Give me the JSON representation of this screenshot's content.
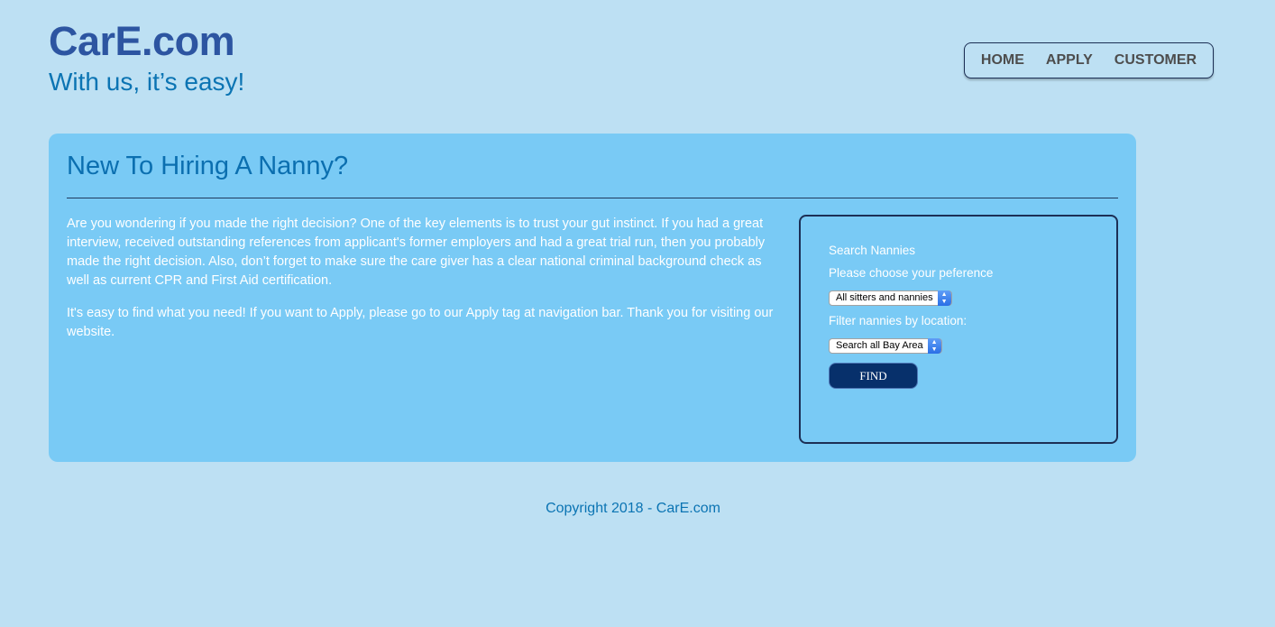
{
  "header": {
    "logo": "CarE.com",
    "tagline": "With us, it’s easy!"
  },
  "nav": {
    "items": [
      "HOME",
      "APPLY",
      "CUSTOMER"
    ]
  },
  "main": {
    "title": "New To Hiring A Nanny?",
    "paragraphs": [
      "Are you wondering if you made the right decision? One of the key elements is to trust your gut instinct. If you had a great interview, received outstanding references from applicant's former employers and had a great trial run, then you probably made the right decision. Also, don’t forget to make sure the care giver has a clear national criminal background check as well as current CPR and First Aid certification.",
      "It's easy to find what you need! If you want to Apply, please go to our Apply tag at navigation bar. Thank you for visiting our website."
    ]
  },
  "search": {
    "heading": "Search Nannies",
    "preference_label": "Please choose your peference",
    "preference_value": "All sitters and nannies",
    "location_label": "Filter nannies by location:",
    "location_value": "Search all Bay Area",
    "find_label": "FIND"
  },
  "footer": {
    "copyright": "Copyright 2018 - CarE.com"
  }
}
